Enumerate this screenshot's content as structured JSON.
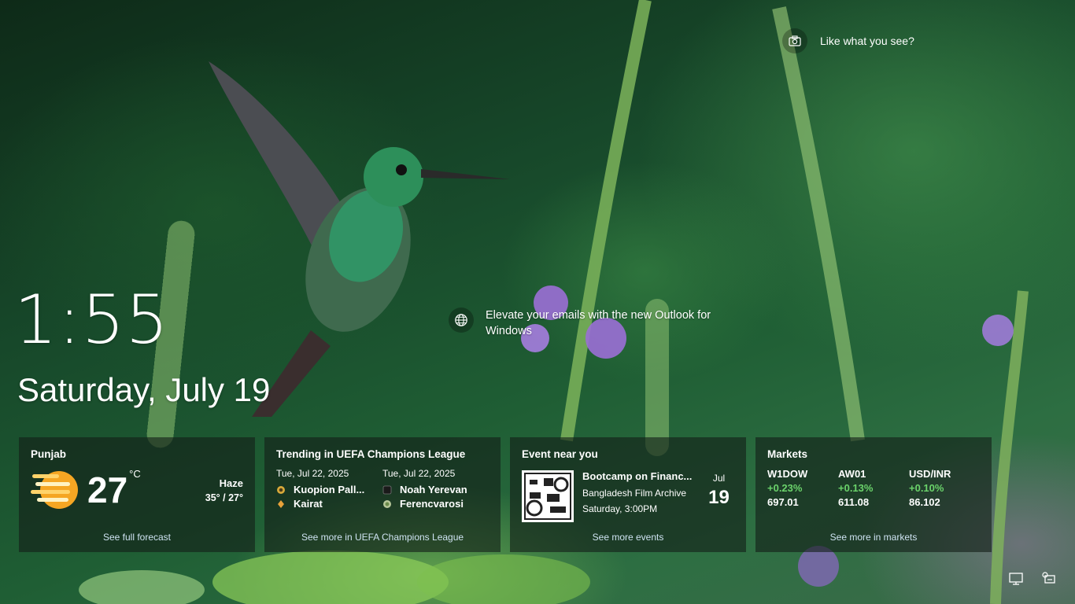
{
  "clock": {
    "time": "1:55",
    "date": "Saturday, July 19"
  },
  "spotlight": {
    "label": "Like what you see?",
    "icon": "camera-icon"
  },
  "promo": {
    "text": "Elevate your emails with the new Outlook for Windows",
    "icon": "globe-icon"
  },
  "weather": {
    "location": "Punjab",
    "temp": "27",
    "unit": "°C",
    "condition": "Haze",
    "range": "35° / 27°",
    "link": "See full forecast",
    "icon": "haze-sun-icon",
    "icon_color": "#f5a623"
  },
  "sports": {
    "title": "Trending in UEFA Champions League",
    "matches": [
      {
        "date": "Tue, Jul 22, 2025",
        "team1": "Kuopion Pall...",
        "team2": "Kairat"
      },
      {
        "date": "Tue, Jul 22, 2025",
        "team1": "Noah Yerevan",
        "team2": "Ferencvarosi"
      }
    ],
    "link": "See more in UEFA Champions League"
  },
  "event": {
    "header": "Event near you",
    "title": "Bootcamp on Financ...",
    "venue": "Bangladesh Film Archive",
    "time": "Saturday, 3:00PM",
    "month": "Jul",
    "day": "19",
    "link": "See more events"
  },
  "markets": {
    "title": "Markets",
    "items": [
      {
        "name": "W1DOW",
        "change": "+0.23%",
        "value": "697.01"
      },
      {
        "name": "AW01",
        "change": "+0.13%",
        "value": "611.08"
      },
      {
        "name": "USD/INR",
        "change": "+0.10%",
        "value": "86.102"
      }
    ],
    "link": "See more in markets",
    "positive_color": "#6bd36b"
  },
  "tray": {
    "icons": [
      "network-icon",
      "accessibility-icon"
    ]
  }
}
